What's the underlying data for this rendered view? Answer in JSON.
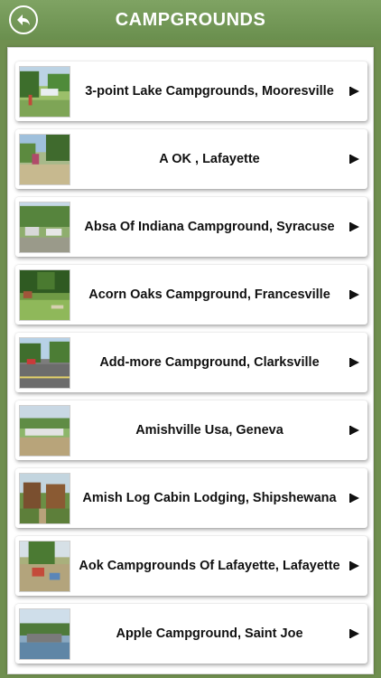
{
  "header": {
    "title": "CAMPGROUNDS",
    "back_icon": "back-arrow-icon",
    "background_color": "#6f8f4f"
  },
  "list": {
    "items": [
      {
        "label": "3-point Lake Campgrounds, Mooresville",
        "thumb": "campground-photo"
      },
      {
        "label": "A OK , Lafayette",
        "thumb": "campground-photo"
      },
      {
        "label": "Absa Of Indiana Campground, Syracuse",
        "thumb": "campground-photo"
      },
      {
        "label": "Acorn Oaks Campground, Francesville",
        "thumb": "campground-photo"
      },
      {
        "label": "Add-more Campground, Clarksville",
        "thumb": "campground-photo"
      },
      {
        "label": "Amishville Usa, Geneva",
        "thumb": "campground-photo"
      },
      {
        "label": "Amish Log Cabin Lodging, Shipshewana",
        "thumb": "campground-photo"
      },
      {
        "label": "Aok Campgrounds Of Lafayette, Lafayette",
        "thumb": "campground-photo"
      },
      {
        "label": "Apple Campground, Saint Joe",
        "thumb": "campground-photo"
      }
    ],
    "row_icon": "play-arrow-icon"
  }
}
